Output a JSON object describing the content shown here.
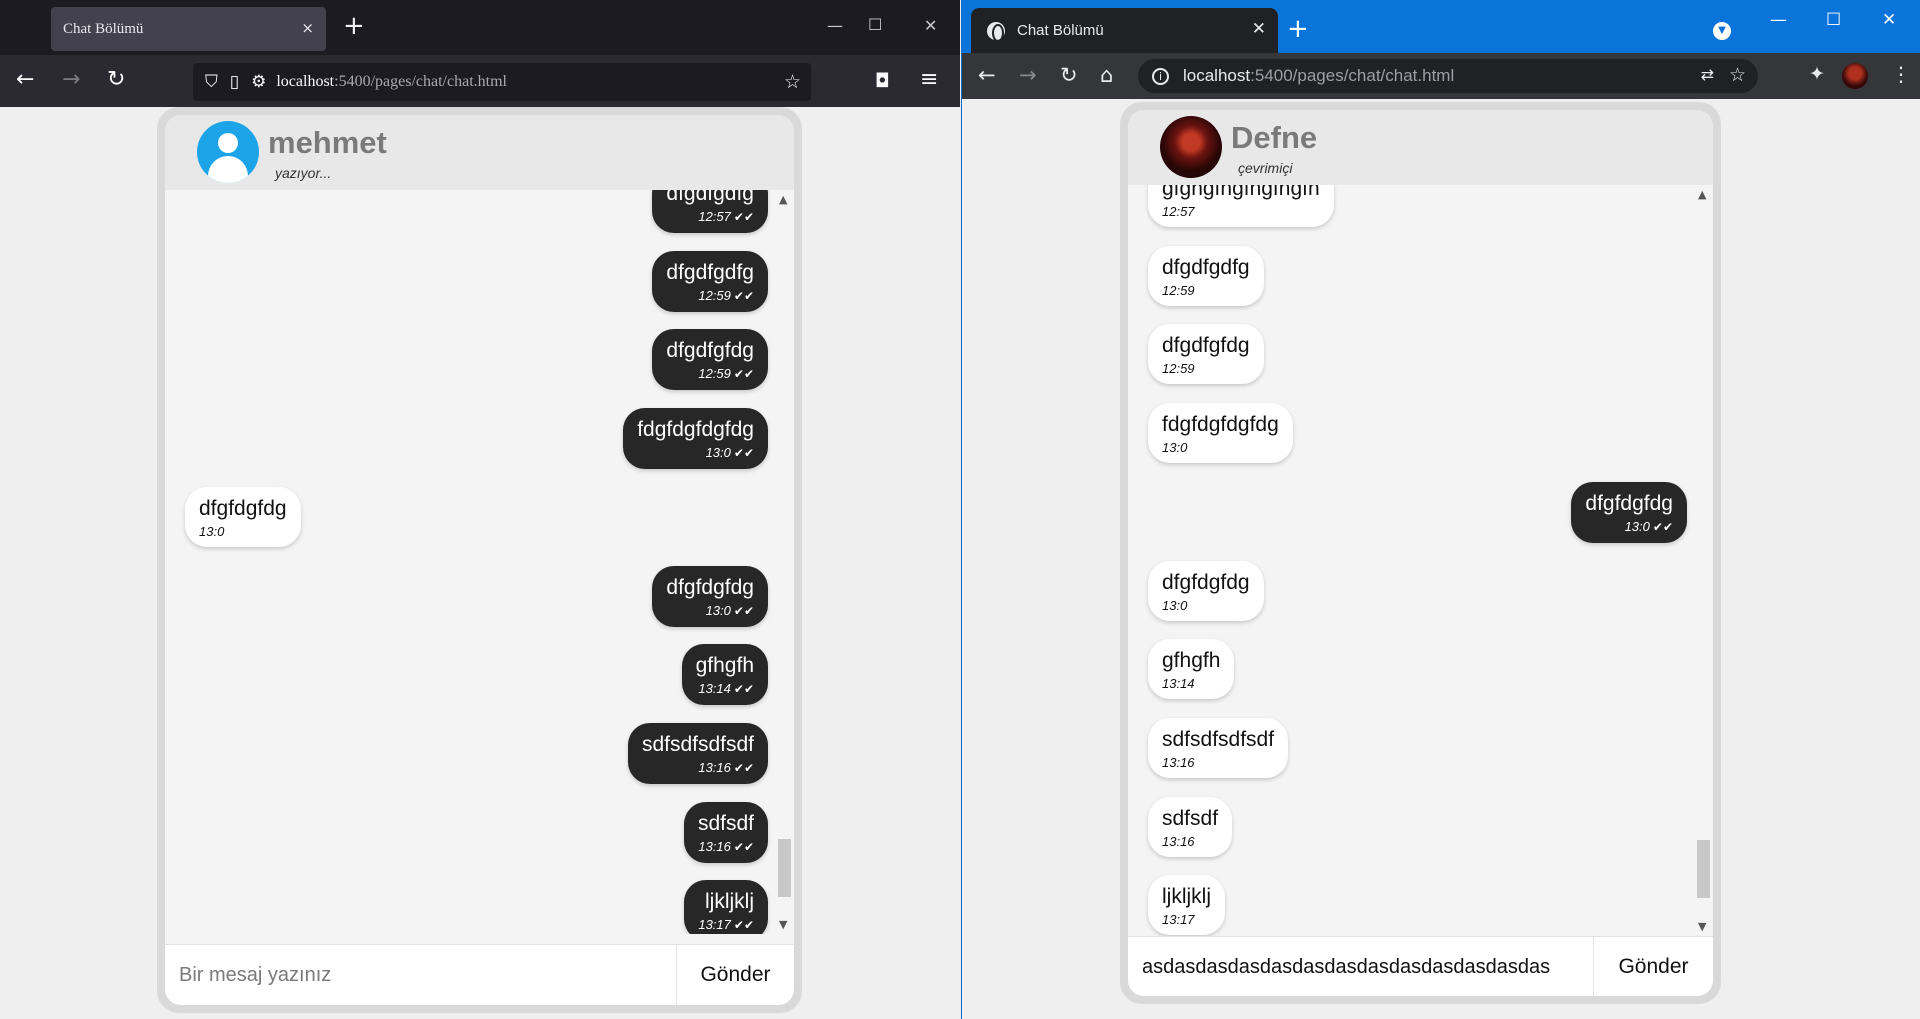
{
  "firefox": {
    "tab_title": "Chat Bölümü",
    "url_host": "localhost",
    "url_path": ":5400/pages/chat/chat.html",
    "chat": {
      "contact_name": "mehmet",
      "contact_status": "yazıyor...",
      "messages": [
        {
          "side": "sent",
          "text": "dfgdfgdfg",
          "time": "12:57",
          "ticks": "✔✔",
          "partial": true
        },
        {
          "side": "sent",
          "text": "dfgdfgdfg",
          "time": "12:59",
          "ticks": "✔✔"
        },
        {
          "side": "sent",
          "text": "dfgdfgfdg",
          "time": "12:59",
          "ticks": "✔✔"
        },
        {
          "side": "sent",
          "text": "fdgfdgfdgfdg",
          "time": "13:0",
          "ticks": "✔✔"
        },
        {
          "side": "recv",
          "text": "dfgfdgfdg",
          "time": "13:0"
        },
        {
          "side": "sent",
          "text": "dfgfdgfdg",
          "time": "13:0",
          "ticks": "✔✔"
        },
        {
          "side": "sent",
          "text": "gfhgfh",
          "time": "13:14",
          "ticks": "✔✔"
        },
        {
          "side": "sent",
          "text": "sdfsdfsdfsdf",
          "time": "13:16",
          "ticks": "✔✔"
        },
        {
          "side": "sent",
          "text": "sdfsdf",
          "time": "13:16",
          "ticks": "✔✔"
        },
        {
          "side": "sent",
          "text": "ljkljklj",
          "time": "13:17",
          "ticks": "✔✔"
        }
      ],
      "input_value": "",
      "input_placeholder": "Bir mesaj yazınız",
      "send_label": "Gönder",
      "scroll_position": 0.97
    }
  },
  "chrome": {
    "tab_title": "Chat Bölümü",
    "url_host": "localhost",
    "url_path": ":5400/pages/chat/chat.html",
    "chat": {
      "contact_name": "Defne",
      "contact_status": "çevrimiçi",
      "messages": [
        {
          "side": "recv",
          "text": "gfghgfhgfhgfhgfh",
          "time": "12:57",
          "partial": true
        },
        {
          "side": "recv",
          "text": "dfgdfgdfg",
          "time": "12:59"
        },
        {
          "side": "recv",
          "text": "dfgdfgfdg",
          "time": "12:59"
        },
        {
          "side": "recv",
          "text": "fdgfdgfdgfdg",
          "time": "13:0"
        },
        {
          "side": "sent",
          "text": "dfgfdgfdg",
          "time": "13:0",
          "ticks": "✔✔"
        },
        {
          "side": "recv",
          "text": "dfgfdgfdg",
          "time": "13:0"
        },
        {
          "side": "recv",
          "text": "gfhgfh",
          "time": "13:14"
        },
        {
          "side": "recv",
          "text": "sdfsdfsdfsdf",
          "time": "13:16"
        },
        {
          "side": "recv",
          "text": "sdfsdf",
          "time": "13:16"
        },
        {
          "side": "recv",
          "text": "ljkljklj",
          "time": "13:17"
        }
      ],
      "input_value": "asdasdasdasdasdasdasdasdasdasdasdasdas",
      "input_placeholder": "Bir mesaj yazınız",
      "send_label": "Gönder",
      "scroll_position": 0.97
    }
  },
  "icons": {
    "ff_close_tab": "×",
    "ff_new_tab": "+",
    "ff_min": "—",
    "ff_max": "☐",
    "ff_close": "✕",
    "ff_back": "←",
    "ff_forward": "→",
    "ff_reload": "↻",
    "ff_shield": "⛉",
    "ff_page": "▯",
    "ff_perm": "⚙",
    "ff_star": "☆",
    "ff_pocket": "◘",
    "ff_menu": "≡",
    "cr_close_tab": "✕",
    "cr_new_tab": "+",
    "cr_dropdown": "▼",
    "cr_min": "—",
    "cr_max": "☐",
    "cr_close": "✕",
    "cr_back": "←",
    "cr_forward": "→",
    "cr_reload": "↻",
    "cr_home": "⌂",
    "cr_info": "i",
    "cr_translate": "⇄",
    "cr_star": "☆",
    "cr_extensions": "✦",
    "cr_menu": "⋮",
    "scroll_up": "▲",
    "scroll_down": "▼"
  },
  "colors": {
    "sent_bubble": "#272727",
    "recv_bubble": "#ffffff",
    "firefox_toolbar": "#2b2a33",
    "chrome_tabbar": "#0a74da",
    "chat_background": "#f4f4f4"
  }
}
